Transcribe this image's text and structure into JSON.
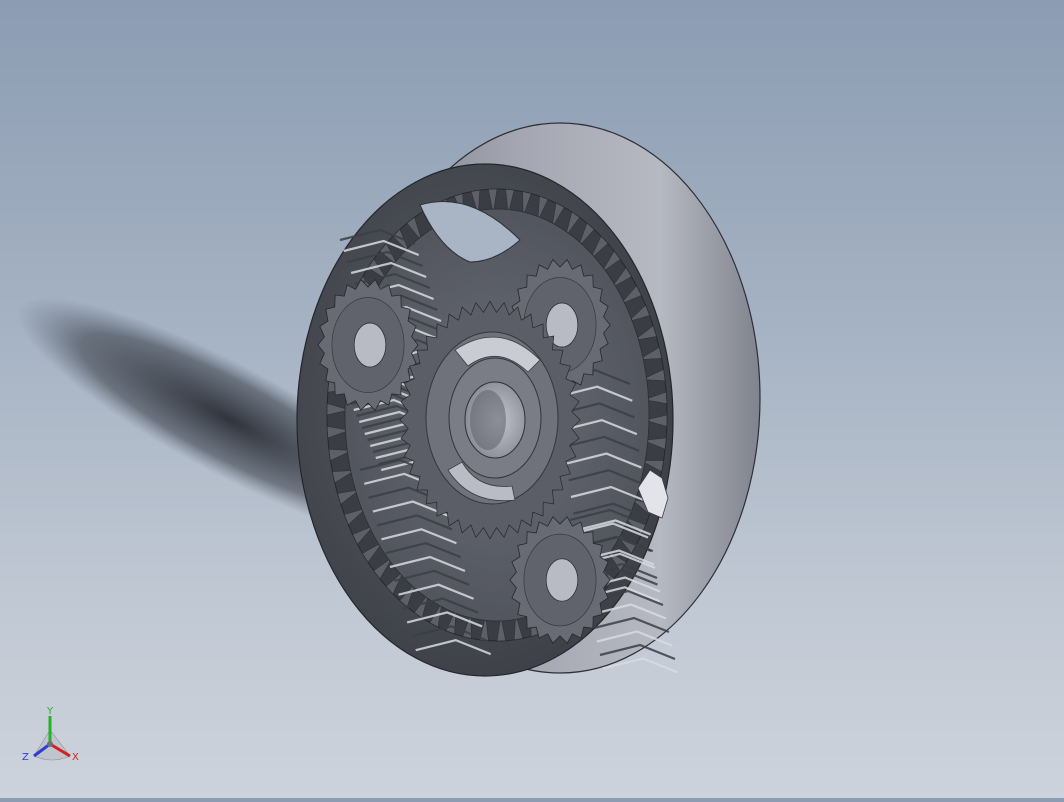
{
  "viewport": {
    "background_top": "#8c9cb2",
    "background_bottom": "#cdd3dc",
    "model": {
      "name": "planetary-gear-assembly",
      "ring_gear_color": "#4a4d55",
      "outer_rim_color": "#9ea1ab",
      "planet_count": 3
    }
  },
  "triad": {
    "y_label": "Y",
    "x_label": "X",
    "z_label": "Z",
    "x_color": "#d42020",
    "y_color": "#26b226",
    "z_color": "#2a3ed8"
  }
}
